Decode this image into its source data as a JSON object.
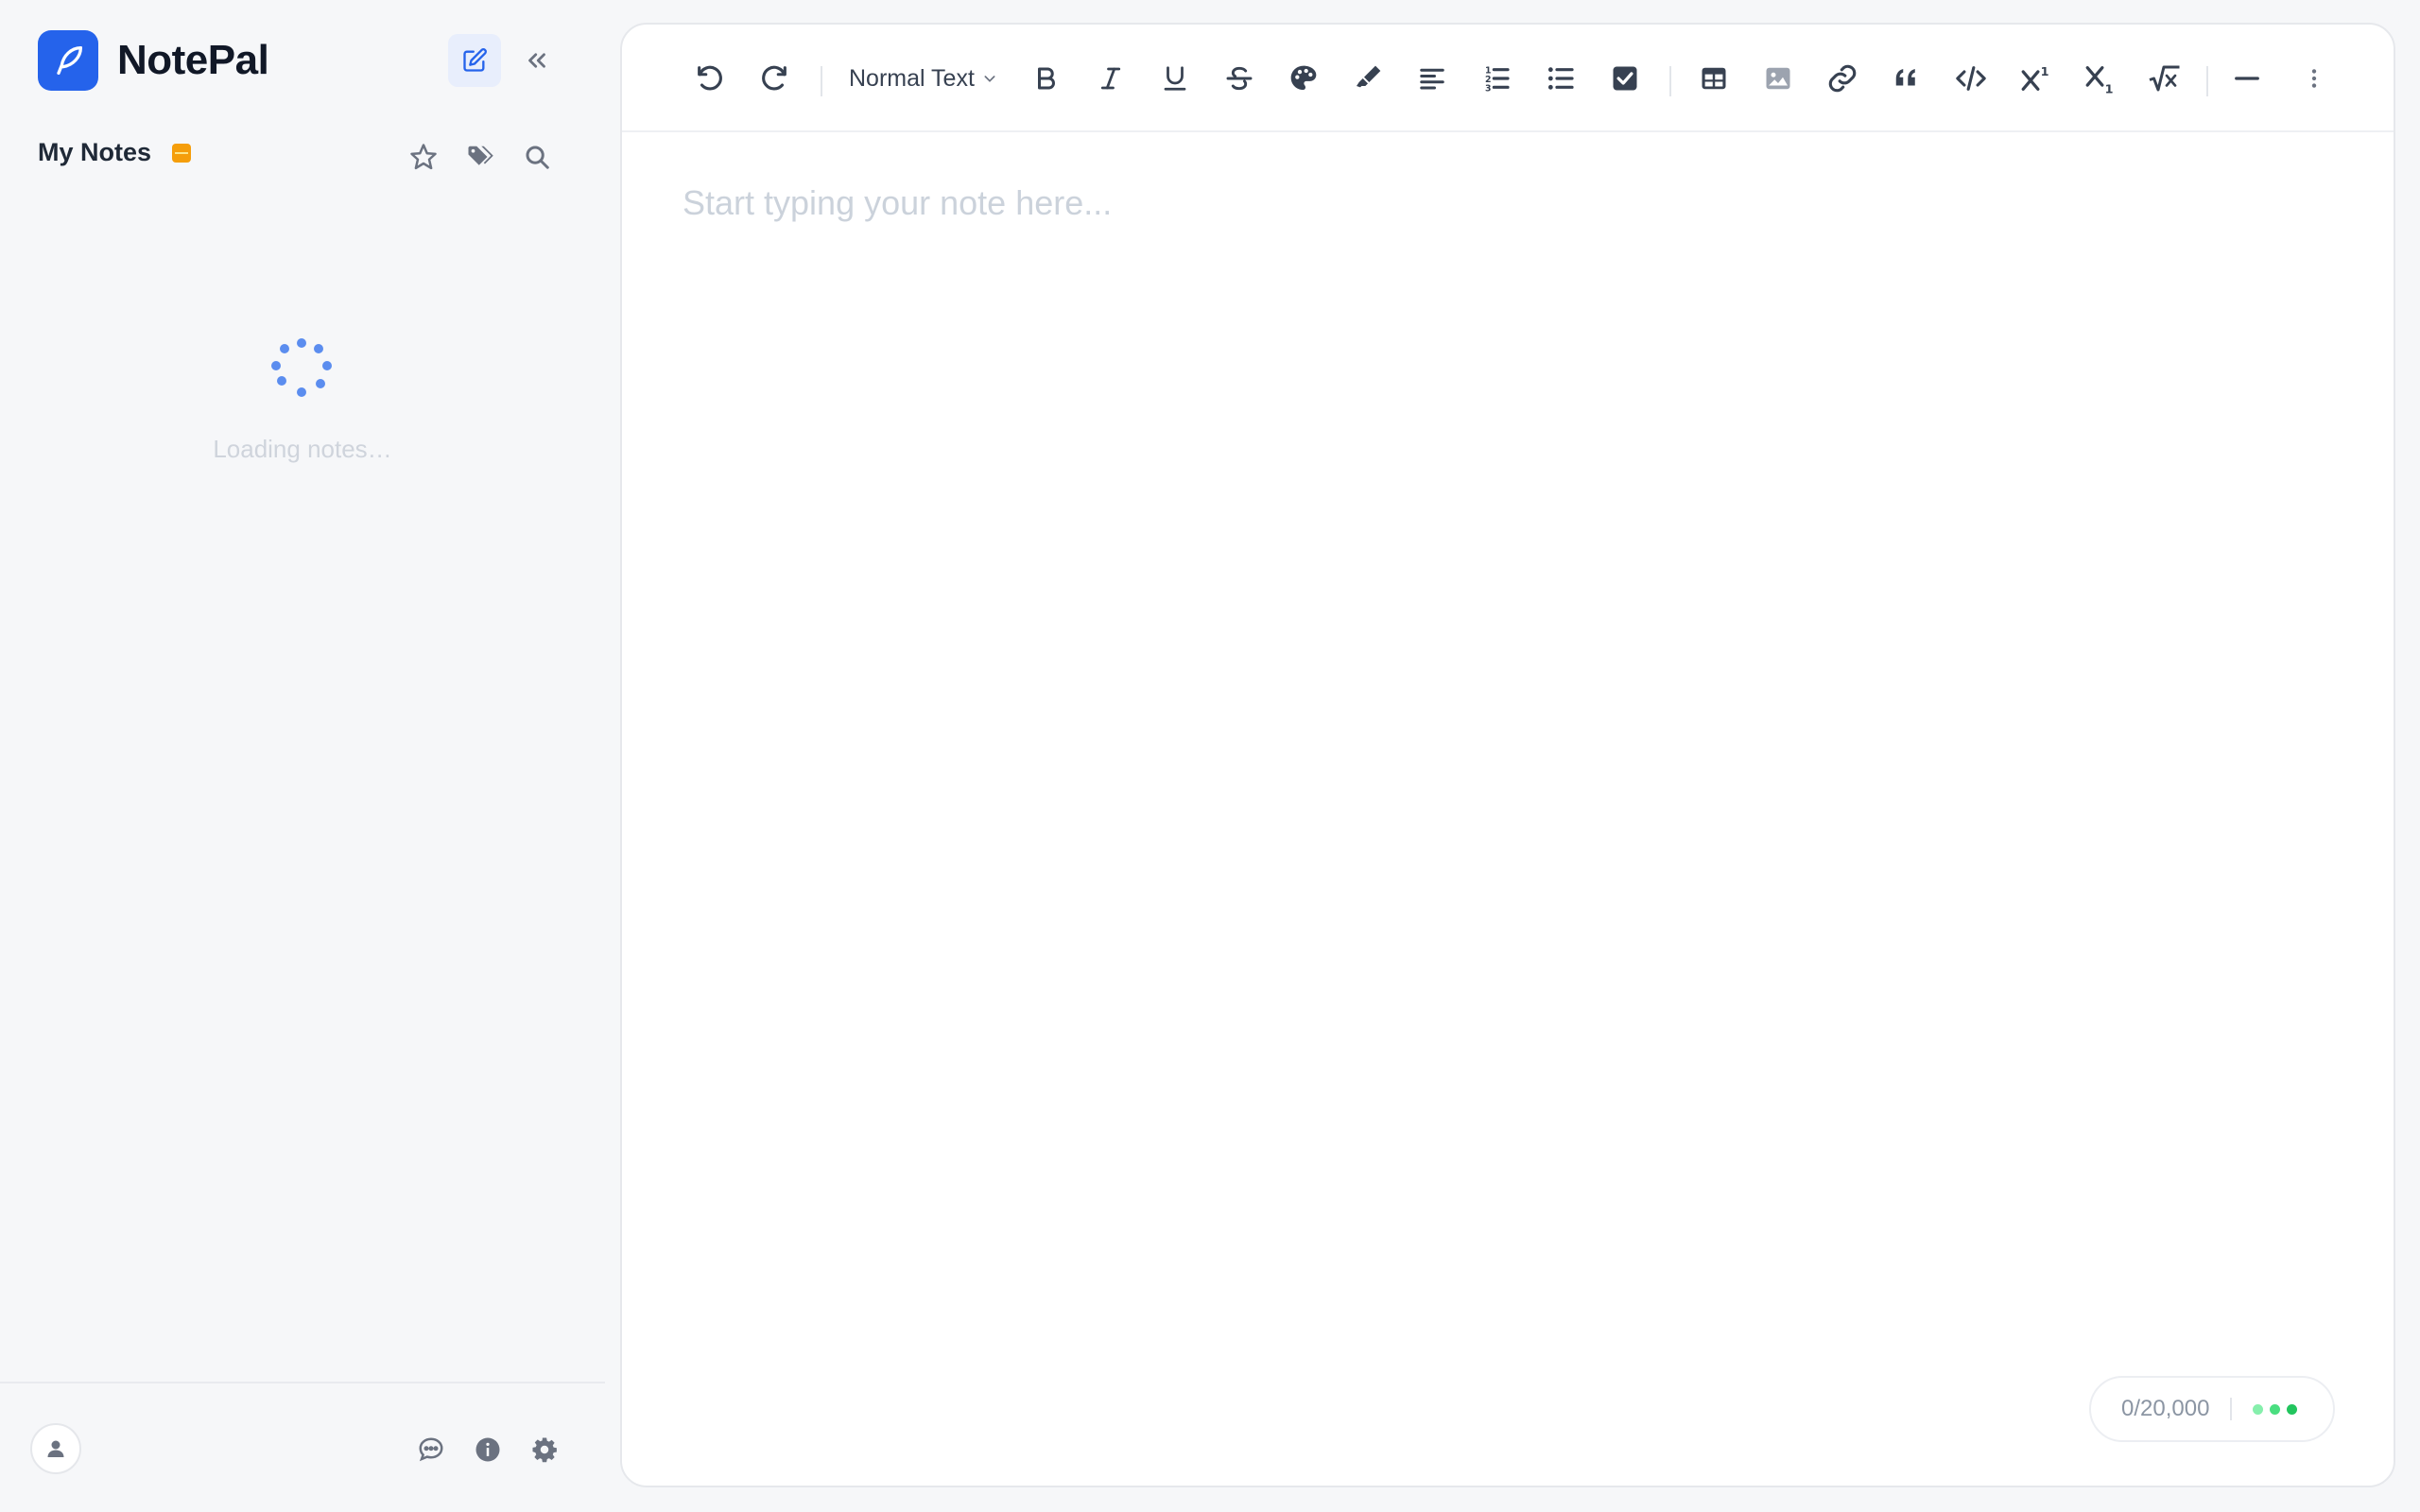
{
  "app": {
    "name": "NotePal",
    "logo_icon": "feather-icon",
    "brand_color": "#2563eb"
  },
  "sidebar": {
    "new_note_icon": "edit-icon",
    "collapse_icon": "chevrons-left-icon",
    "section_title": "My Notes",
    "section_badge_icon": "storage-icon",
    "section_badge_color": "#f59e0b",
    "actions": [
      "star-icon",
      "tags-icon",
      "search-icon"
    ],
    "loading_text": "Loading notes…",
    "footer": {
      "avatar_icon": "user-icon",
      "actions": [
        "chat-icon",
        "info-icon",
        "settings-icon"
      ]
    }
  },
  "toolbar": {
    "format_label": "Normal Text",
    "buttons": [
      "undo",
      "redo",
      "bold",
      "italic",
      "underline",
      "strikethrough",
      "text-color",
      "highlight",
      "align-left",
      "ordered-list",
      "bullet-list",
      "checklist",
      "table",
      "image",
      "link",
      "blockquote",
      "code",
      "superscript",
      "subscript",
      "math",
      "horizontal-rule",
      "more"
    ]
  },
  "editor": {
    "placeholder": "Start typing your note here...",
    "value": ""
  },
  "status": {
    "char_count": "0/20,000",
    "sync_colors": [
      "#86efac",
      "#4ade80",
      "#22c55e"
    ]
  }
}
